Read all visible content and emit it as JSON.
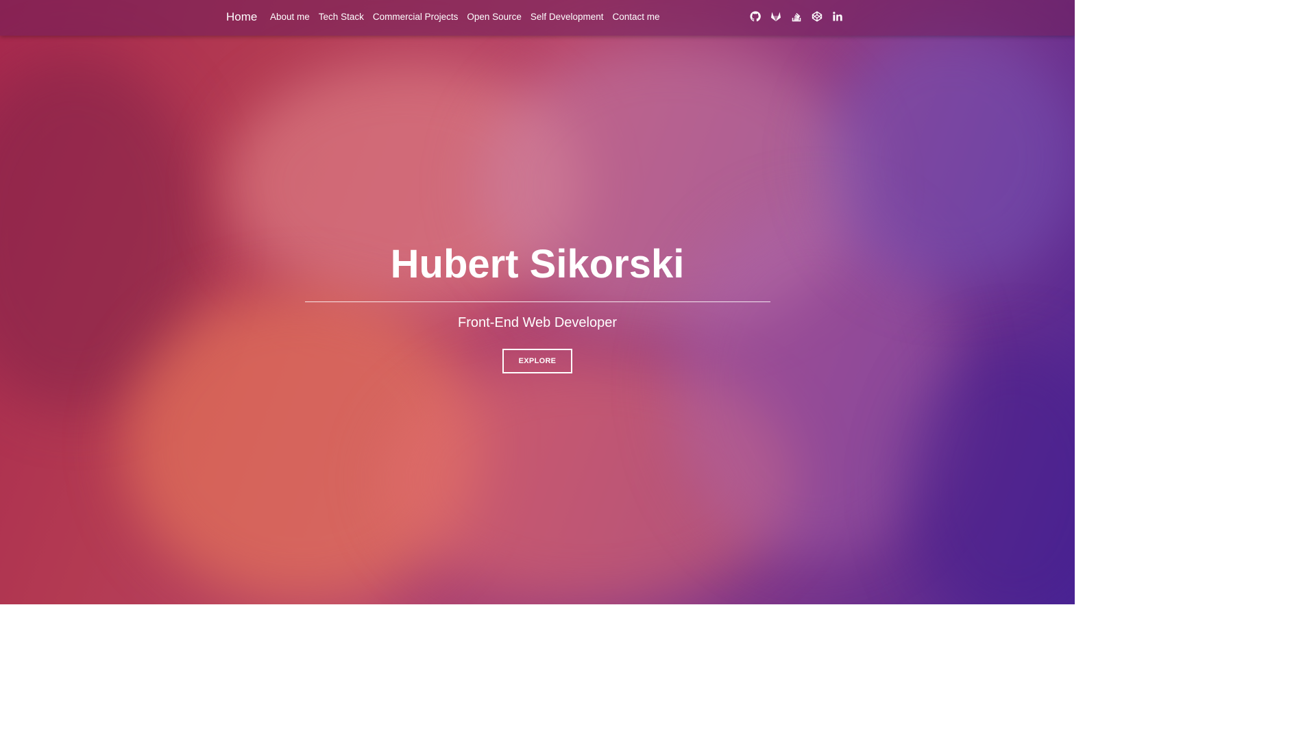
{
  "nav": {
    "brand": "Home",
    "links": [
      {
        "label": "About me"
      },
      {
        "label": "Tech Stack"
      },
      {
        "label": "Commercial Projects"
      },
      {
        "label": "Open Source"
      },
      {
        "label": "Self Development"
      },
      {
        "label": "Contact me"
      }
    ],
    "social_icons": [
      "github-icon",
      "gitlab-icon",
      "stack-overflow-icon",
      "codepen-icon",
      "linkedin-icon"
    ]
  },
  "hero": {
    "name": "Hubert Sikorski",
    "subtitle": "Front-End Web Developer",
    "button_label": "EXPLORE"
  },
  "colors": {
    "text": "#ffffff",
    "gradient_warm": "#b33a52",
    "gradient_cool": "#4a2596"
  }
}
